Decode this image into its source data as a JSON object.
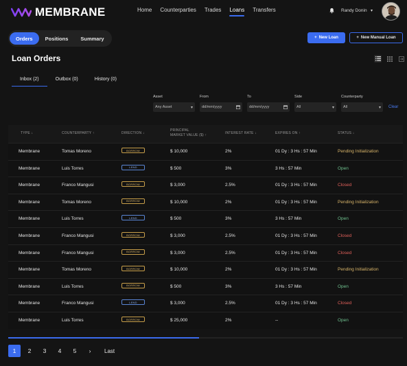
{
  "app": {
    "name": "MEMBRANE"
  },
  "nav": {
    "items": [
      "Home",
      "Counterparties",
      "Trades",
      "Loans",
      "Transfers"
    ],
    "active_index": 3
  },
  "user": {
    "name": "Randy Donin"
  },
  "tabs": {
    "items": [
      "Orders",
      "Positions",
      "Summary"
    ],
    "active_index": 0
  },
  "actions": {
    "new_loan": "New Loan",
    "new_manual_loan": "New Manual Loan",
    "plus": "+"
  },
  "page": {
    "title": "Loan Orders"
  },
  "subtabs": {
    "items": [
      "Inbox (2)",
      "Outbox (0)",
      "History (0)"
    ],
    "active_index": 0
  },
  "filters": {
    "asset": {
      "label": "Asset",
      "value": "Any Asset"
    },
    "from": {
      "label": "From",
      "placeholder": "dd/mm/yyyy"
    },
    "to": {
      "label": "To",
      "placeholder": "dd/mm/yyyy"
    },
    "side": {
      "label": "Side",
      "value": "All"
    },
    "counterparty": {
      "label": "Counterparty",
      "value": "All"
    },
    "clear": "Clear"
  },
  "table": {
    "headers": {
      "type": "TYPE",
      "counterparty": "COUNTERPARTY",
      "direction": "DIRECTION",
      "principal_line1": "PRINCIPAL",
      "principal_line2": "MARKET VALUE ($)",
      "interest": "INTEREST RATE",
      "expires": "EXPIRES ON",
      "status": "STATUS"
    },
    "rows": [
      {
        "type": "Membrane",
        "counterparty": "Tomas  Moreno",
        "direction": "BORROW",
        "principal": "$ 10,000",
        "interest": "2%",
        "expires": "01 Dy : 3 Hs : 57 Min",
        "status": "Pending Initialization"
      },
      {
        "type": "Membrane",
        "counterparty": "Luis Torres",
        "direction": "LEND",
        "principal": "$ 500",
        "interest": "3%",
        "expires": "3 Hs : 57 Min",
        "status": "Open"
      },
      {
        "type": "Membrane",
        "counterparty": "Franco Mangusi",
        "direction": "BORROW",
        "principal": "$ 3,000",
        "interest": "2.5%",
        "expires": "01 Dy : 3 Hs : 57 Min",
        "status": "Closed"
      },
      {
        "type": "Membrane",
        "counterparty": "Tomas  Moreno",
        "direction": "BORROW",
        "principal": "$ 10,000",
        "interest": "2%",
        "expires": "01 Dy : 3 Hs : 57 Min",
        "status": "Pending Initialization"
      },
      {
        "type": "Membrane",
        "counterparty": "Luis Torres",
        "direction": "LEND",
        "principal": "$ 500",
        "interest": "3%",
        "expires": "3 Hs : 57 Min",
        "status": "Open"
      },
      {
        "type": "Membrane",
        "counterparty": "Franco Mangusi",
        "direction": "BORROW",
        "principal": "$ 3,000",
        "interest": "2.5%",
        "expires": "01 Dy : 3 Hs : 57 Min",
        "status": "Closed"
      },
      {
        "type": "Membrane",
        "counterparty": "Franco Mangusi",
        "direction": "BORROW",
        "principal": "$ 3,000",
        "interest": "2.5%",
        "expires": "01 Dy : 3 Hs : 57 Min",
        "status": "Closed"
      },
      {
        "type": "Membrane",
        "counterparty": "Tomas  Moreno",
        "direction": "BORROW",
        "principal": "$ 10,000",
        "interest": "2%",
        "expires": "01 Dy : 3 Hs : 57 Min",
        "status": "Pending Initialization"
      },
      {
        "type": "Membrane",
        "counterparty": "Luis Torres",
        "direction": "BORROW",
        "principal": "$ 500",
        "interest": "3%",
        "expires": "3 Hs : 57 Min",
        "status": "Open"
      },
      {
        "type": "Membrane",
        "counterparty": "Franco Mangusi",
        "direction": "LEND",
        "principal": "$ 3,000",
        "interest": "2.5%",
        "expires": "01 Dy : 3 Hs : 57 Min",
        "status": "Closed"
      },
      {
        "type": "Membrane",
        "counterparty": "Luis Torres",
        "direction": "BORROW",
        "principal": "$ 25,000",
        "interest": "2%",
        "expires": "--",
        "status": "Open"
      }
    ]
  },
  "scroll": {
    "fraction": 0.483
  },
  "pagination": {
    "pages": [
      "1",
      "2",
      "3",
      "4",
      "5"
    ],
    "next": "›",
    "last": "Last",
    "active_index": 0
  },
  "colors": {
    "accent": "#3b6cf0",
    "status_pending": "#d9b56a",
    "status_open": "#6fc08e",
    "status_closed": "#e0605a",
    "borrow": "#c9a04a",
    "lend": "#5a86d6"
  }
}
